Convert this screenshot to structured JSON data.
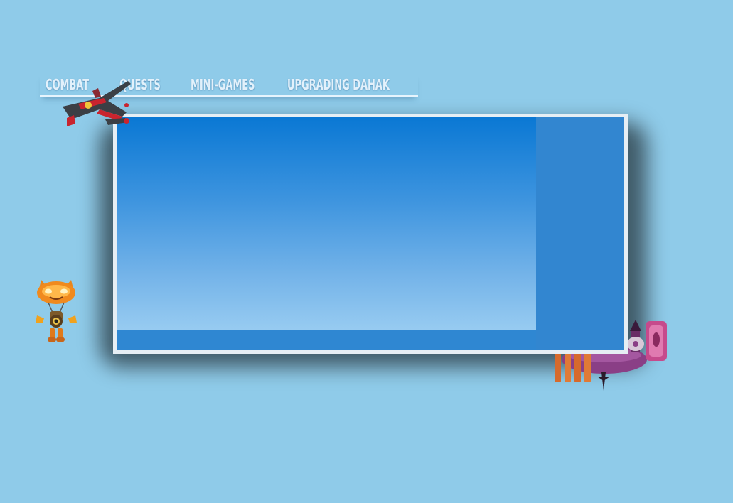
{
  "nav": {
    "items": [
      {
        "label": "COMBAT"
      },
      {
        "label": "QUESTS"
      },
      {
        "label": "MINI-GAMES"
      },
      {
        "label": "UPGRADING DAHAK"
      }
    ]
  },
  "sprites": {
    "ship": "spaceship-icon",
    "cat": "robot-cat-icon",
    "tower": "alien-tower-icon"
  },
  "colors": {
    "background": "#8fcbe9",
    "panel": "#2f87d2",
    "panel_border": "#e6eef4",
    "nav_text": "#e3f1fb"
  }
}
